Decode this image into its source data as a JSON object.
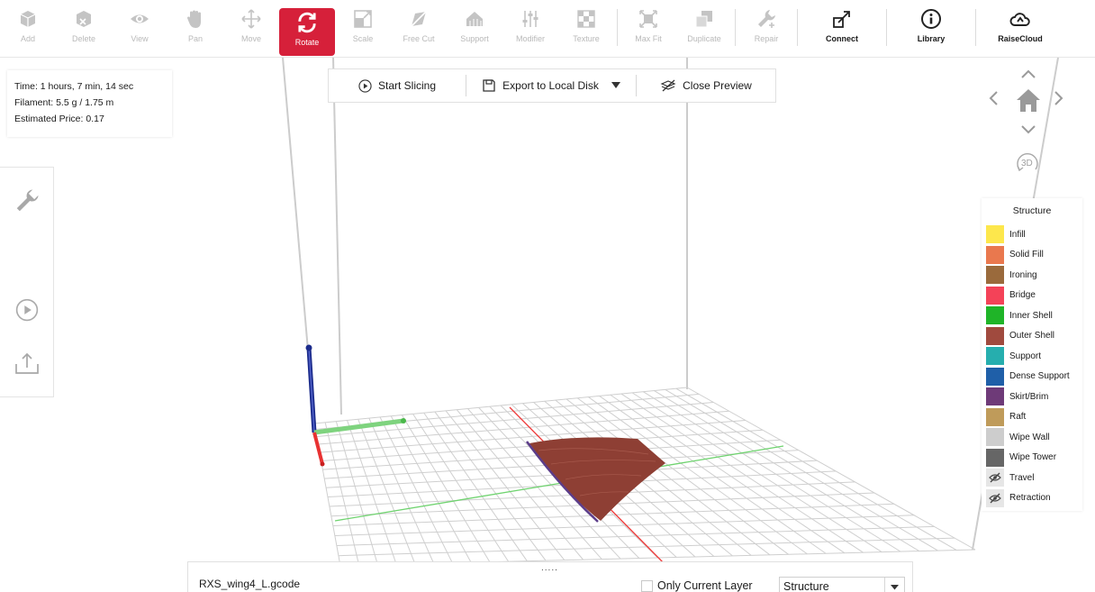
{
  "toolbar": {
    "add": "Add",
    "delete": "Delete",
    "view": "View",
    "pan": "Pan",
    "move": "Move",
    "rotate": "Rotate",
    "scale": "Scale",
    "free_cut": "Free Cut",
    "support": "Support",
    "modifier": "Modifier",
    "texture": "Texture",
    "max_fit": "Max Fit",
    "duplicate": "Duplicate",
    "repair": "Repair",
    "connect": "Connect",
    "library": "Library",
    "raisecloud": "RaiseCloud",
    "active_tool": "rotate",
    "accent_color": "#d6203a"
  },
  "info": {
    "time": "Time: 1 hours, 7 min, 14 sec",
    "filament": "Filament: 5.5 g / 1.75 m",
    "price": "Estimated Price: 0.17"
  },
  "slicebar": {
    "start_slicing": "Start Slicing",
    "export": "Export to Local Disk",
    "close_preview": "Close Preview"
  },
  "nav": {
    "view_3d": "3D"
  },
  "legend": {
    "title": "Structure",
    "items": [
      {
        "label": "Infill",
        "color": "#fde74c"
      },
      {
        "label": "Solid Fill",
        "color": "#e9784e"
      },
      {
        "label": "Ironing",
        "color": "#9a6a3c"
      },
      {
        "label": "Bridge",
        "color": "#f44258"
      },
      {
        "label": "Inner Shell",
        "color": "#1fb428"
      },
      {
        "label": "Outer Shell",
        "color": "#a04a3e"
      },
      {
        "label": "Support",
        "color": "#26aeae"
      },
      {
        "label": "Dense Support",
        "color": "#1f5fa8"
      },
      {
        "label": "Skirt/Brim",
        "color": "#6e3a78"
      },
      {
        "label": "Raft",
        "color": "#bf9b5a"
      },
      {
        "label": "Wipe Wall",
        "color": "#cdcdcd"
      },
      {
        "label": "Wipe Tower",
        "color": "#666666"
      },
      {
        "label": "Travel",
        "icon": "eye-off-icon"
      },
      {
        "label": "Retraction",
        "icon": "eye-off-icon"
      }
    ]
  },
  "bottom": {
    "filename": "RXS_wing4_L.gcode",
    "handle": ".....",
    "only_current_layer": "Only Current Layer",
    "view_mode": "Structure"
  }
}
